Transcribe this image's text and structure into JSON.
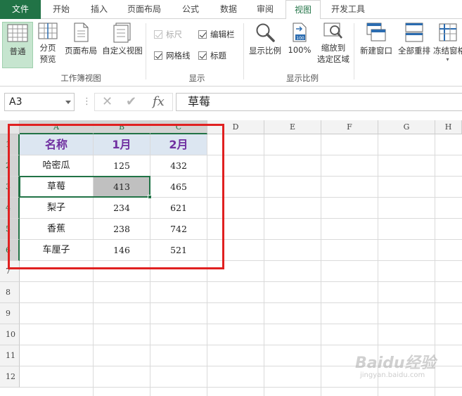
{
  "ribbon_tabs": {
    "file": "文件",
    "home": "开始",
    "insert": "插入",
    "page_layout": "页面布局",
    "formulas": "公式",
    "data": "数据",
    "review": "审阅",
    "view": "视图",
    "developer": "开发工具"
  },
  "ribbon": {
    "workbook_views": {
      "normal": "普通",
      "page_break_1": "分页",
      "page_break_2": "预览",
      "page_layout": "页面布局",
      "custom_views": "自定义视图",
      "group_label": "工作簿视图"
    },
    "show": {
      "ruler": "标尺",
      "formula_bar": "编辑栏",
      "gridlines": "网格线",
      "headings": "标题",
      "group_label": "显示"
    },
    "zoom": {
      "zoom": "显示比例",
      "hundred": "100%",
      "hundred_icon_text": "100",
      "zoom_to_selection_1": "缩放到",
      "zoom_to_selection_2": "选定区域",
      "group_label": "显示比例"
    },
    "window": {
      "new_window": "新建窗口",
      "arrange_all": "全部重排",
      "freeze_panes": "冻结窗格"
    }
  },
  "formula_bar": {
    "name_box": "A3",
    "content": "草莓",
    "dots": "⋮",
    "cancel": "✕",
    "enter": "✔",
    "fx": "fx"
  },
  "columns": [
    "A",
    "B",
    "C",
    "D",
    "E",
    "F",
    "G",
    "H"
  ],
  "rows": [
    "1",
    "2",
    "3",
    "4",
    "5",
    "6",
    "7",
    "8",
    "9",
    "10",
    "11",
    "12"
  ],
  "table": {
    "headers": [
      "名称",
      "1月",
      "2月"
    ],
    "rows": [
      [
        "哈密瓜",
        "125",
        "432"
      ],
      [
        "草莓",
        "413",
        "465"
      ],
      [
        "梨子",
        "234",
        "621"
      ],
      [
        "香蕉",
        "238",
        "742"
      ],
      [
        "车厘子",
        "146",
        "521"
      ]
    ]
  },
  "watermark": {
    "brand": "Baidu经验",
    "url": "jingyan.baidu.com"
  },
  "colors": {
    "excel_green": "#217346",
    "header_text": "#7030a0",
    "header_fill": "#dce6f1",
    "annotation_red": "#e02020"
  }
}
